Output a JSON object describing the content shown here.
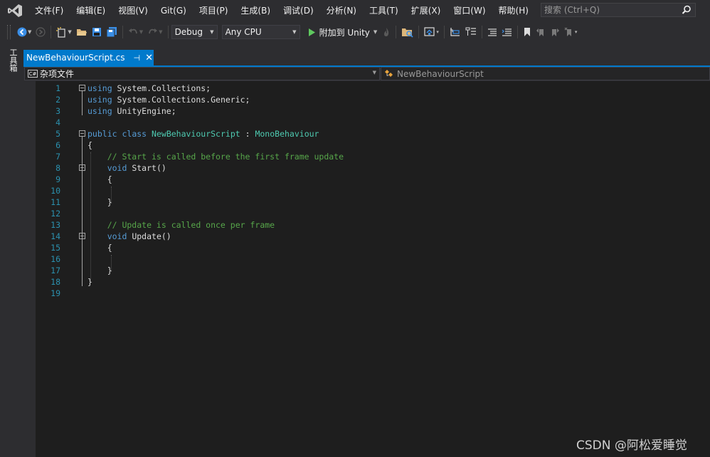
{
  "menu": {
    "items": [
      "文件(F)",
      "编辑(E)",
      "视图(V)",
      "Git(G)",
      "项目(P)",
      "生成(B)",
      "调试(D)",
      "分析(N)",
      "工具(T)",
      "扩展(X)",
      "窗口(W)",
      "帮助(H)"
    ],
    "search_placeholder": "搜索 (Ctrl+Q)"
  },
  "toolbar": {
    "configuration": "Debug",
    "platform": "Any CPU",
    "attach_label": "附加到 Unity"
  },
  "left_strip": {
    "toolbox_label": "工具箱"
  },
  "document_tab": {
    "title": "NewBehaviourScript.cs"
  },
  "navigation_bar": {
    "project": "杂项文件",
    "type": "NewBehaviourScript"
  },
  "editor": {
    "lines": [
      [
        {
          "t": "using",
          "c": "kw"
        },
        {
          "t": " System.Collections;",
          "c": ""
        }
      ],
      [
        {
          "t": "using",
          "c": "kw"
        },
        {
          "t": " System.Collections.Generic;",
          "c": ""
        }
      ],
      [
        {
          "t": "using",
          "c": "kw"
        },
        {
          "t": " UnityEngine;",
          "c": ""
        }
      ],
      [],
      [
        {
          "t": "public",
          "c": "kw"
        },
        {
          "t": " ",
          "c": ""
        },
        {
          "t": "class",
          "c": "kw"
        },
        {
          "t": " ",
          "c": ""
        },
        {
          "t": "NewBehaviourScript",
          "c": "ty"
        },
        {
          "t": " : ",
          "c": ""
        },
        {
          "t": "MonoBehaviour",
          "c": "ty"
        }
      ],
      [
        {
          "t": "{",
          "c": ""
        }
      ],
      [
        {
          "t": "    // Start is called before the first frame update",
          "c": "cm"
        }
      ],
      [
        {
          "t": "    ",
          "c": ""
        },
        {
          "t": "void",
          "c": "kw"
        },
        {
          "t": " Start()",
          "c": ""
        }
      ],
      [
        {
          "t": "    {",
          "c": ""
        }
      ],
      [],
      [
        {
          "t": "    }",
          "c": ""
        }
      ],
      [],
      [
        {
          "t": "    // Update is called once per frame",
          "c": "cm"
        }
      ],
      [
        {
          "t": "    ",
          "c": ""
        },
        {
          "t": "void",
          "c": "kw"
        },
        {
          "t": " Update()",
          "c": ""
        }
      ],
      [
        {
          "t": "    {",
          "c": ""
        }
      ],
      [],
      [
        {
          "t": "    }",
          "c": ""
        }
      ],
      [
        {
          "t": "}",
          "c": ""
        }
      ],
      []
    ],
    "fold_markers": [
      1,
      5,
      8,
      14
    ]
  },
  "watermark": {
    "text": "CSDN @阿松爱睡觉"
  },
  "colors": {
    "keyword": "#569cd6",
    "type": "#4ec9b0",
    "comment": "#57a64a",
    "line_number": "#2b91af",
    "accent": "#007acc",
    "editor_bg": "#1e1e1e"
  }
}
